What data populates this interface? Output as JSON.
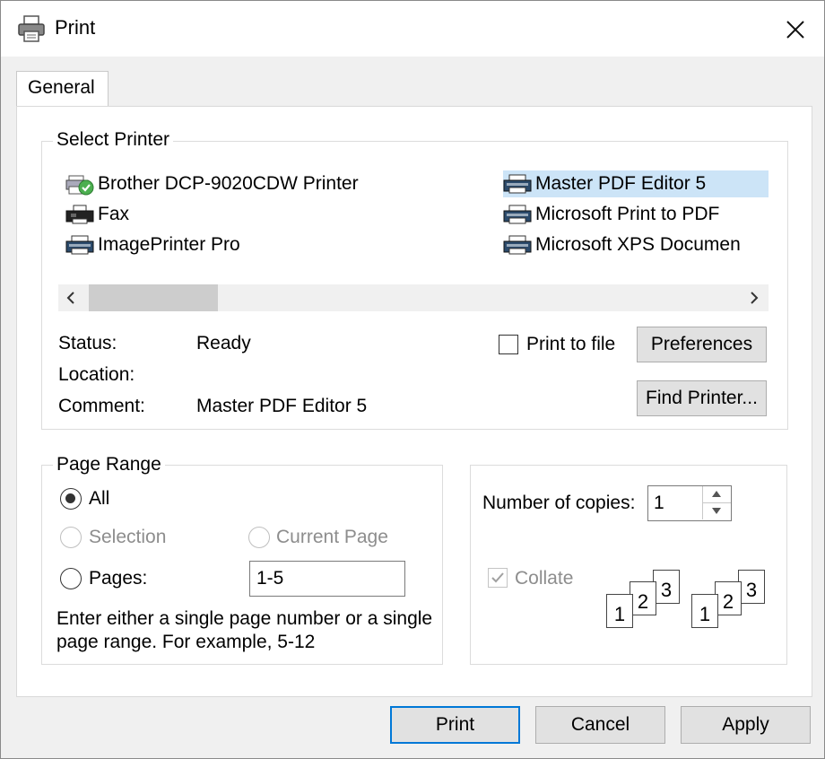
{
  "window": {
    "title": "Print"
  },
  "tabs": [
    {
      "label": "General"
    }
  ],
  "select_printer": {
    "group_label": "Select Printer",
    "printers": [
      {
        "name": "Brother DCP-9020CDW Printer",
        "icon": "default-printer-icon",
        "selected": false
      },
      {
        "name": "Fax",
        "icon": "fax-icon",
        "selected": false
      },
      {
        "name": "ImagePrinter Pro",
        "icon": "printer-icon",
        "selected": false
      },
      {
        "name": "Master PDF Editor 5",
        "icon": "printer-icon",
        "selected": true
      },
      {
        "name": "Microsoft Print to PDF",
        "icon": "printer-icon",
        "selected": false
      },
      {
        "name": "Microsoft XPS Documen",
        "icon": "printer-icon",
        "selected": false
      }
    ],
    "status_label": "Status:",
    "status_value": "Ready",
    "location_label": "Location:",
    "location_value": "",
    "comment_label": "Comment:",
    "comment_value": "Master PDF Editor 5",
    "print_to_file_label": "Print to file",
    "print_to_file_checked": false,
    "preferences_button": "Preferences",
    "find_printer_button": "Find Printer..."
  },
  "page_range": {
    "group_label": "Page Range",
    "all_label": "All",
    "selection_label": "Selection",
    "current_page_label": "Current Page",
    "pages_label": "Pages:",
    "pages_value": "1-5",
    "selected": "All",
    "help_line1": "Enter either a single page number or a single",
    "help_line2": "page range.  For example, 5-12"
  },
  "copies": {
    "number_label": "Number of copies:",
    "number_value": "1",
    "collate_label": "Collate",
    "collate_checked": true,
    "collate_pages": [
      "1",
      "2",
      "3"
    ]
  },
  "footer": {
    "print_button": "Print",
    "cancel_button": "Cancel",
    "apply_button": "Apply"
  }
}
